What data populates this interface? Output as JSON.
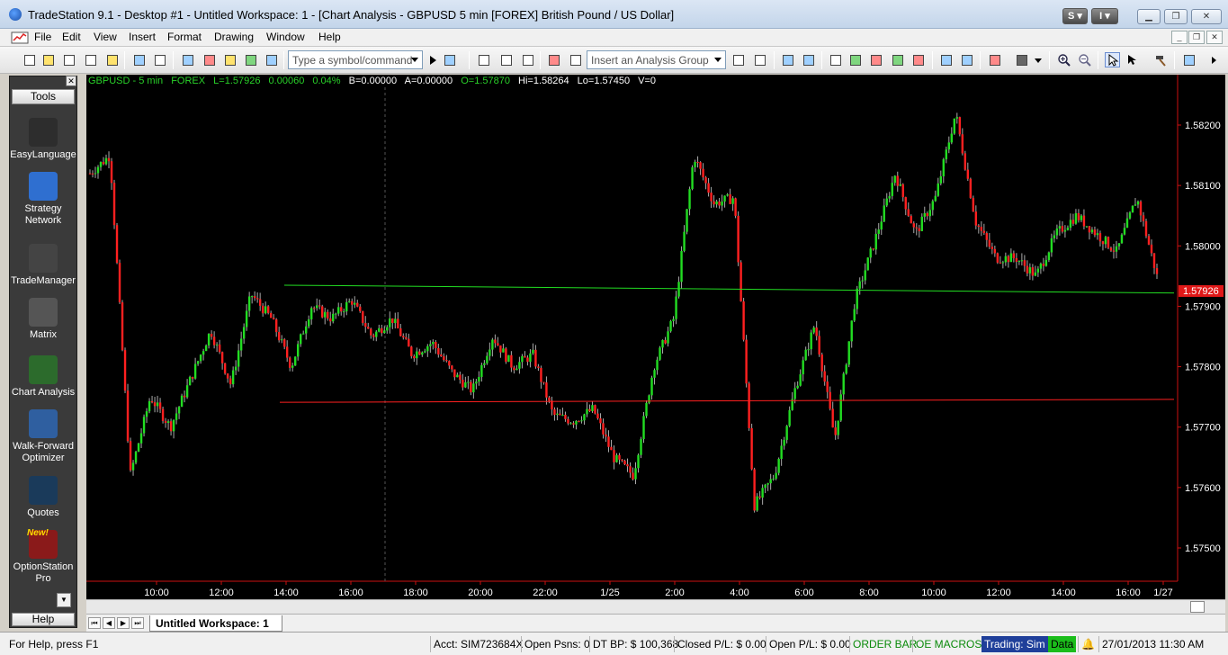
{
  "window": {
    "title": "TradeStation 9.1 - Desktop #1 - Untitled Workspace:  1 - [Chart Analysis - GBPUSD 5 min [FOREX] British Pound / US Dollar]",
    "s_button": "S",
    "i_button": "I"
  },
  "menu": {
    "items": [
      "File",
      "Edit",
      "View",
      "Insert",
      "Format",
      "Drawing",
      "Window",
      "Help"
    ]
  },
  "toolbar": {
    "symbol_placeholder": "Type a symbol/command",
    "analysis_group_placeholder": "Insert an Analysis Group"
  },
  "tools": {
    "header": "Tools",
    "footer": "Help",
    "items": [
      {
        "line1": "EasyLanguage",
        "line2": "",
        "icon": "easylanguage-icon",
        "color": "#2d2d2d"
      },
      {
        "line1": "Strategy",
        "line2": "Network",
        "icon": "strategy-network-icon",
        "color": "#2f6fd0"
      },
      {
        "line1": "TradeManager",
        "line2": "",
        "icon": "trademanager-icon",
        "color": "#444444"
      },
      {
        "line1": "Matrix",
        "line2": "",
        "icon": "matrix-icon",
        "color": "#555555"
      },
      {
        "line1": "Chart Analysis",
        "line2": "",
        "icon": "chart-analysis-icon",
        "color": "#2c6b2c"
      },
      {
        "line1": "Walk-Forward",
        "line2": "Optimizer",
        "icon": "walk-forward-optimizer-icon",
        "color": "#2f5fa0"
      },
      {
        "line1": "Quotes",
        "line2": "",
        "icon": "quotes-icon",
        "color": "#1a3a5a"
      },
      {
        "line1": "OptionStation",
        "line2": "Pro",
        "icon": "optionstation-pro-icon",
        "color": "#8a1a1a",
        "badge": "New!"
      }
    ]
  },
  "chart_header": {
    "symbol": "GBPUSD - 5 min",
    "exchange": "FOREX",
    "last": "L=1.57926",
    "change": "0.00060",
    "change_pct": "0.04%",
    "bid": "B=0.00000",
    "ask": "A=0.00000",
    "open": "O=1.57870",
    "high": "Hi=1.58264",
    "low": "Lo=1.57450",
    "volume": "V=0",
    "colors": {
      "green": "#29d129",
      "white": "#ffffff"
    }
  },
  "chart_data": {
    "type": "candlestick",
    "y_ticks": [
      "1.58200",
      "1.58100",
      "1.58000",
      "1.57900",
      "1.57800",
      "1.57700",
      "1.57600",
      "1.57500"
    ],
    "x_ticks": [
      "10:00",
      "12:00",
      "14:00",
      "16:00",
      "18:00",
      "20:00",
      "22:00",
      "1/25",
      "2:00",
      "4:00",
      "6:00",
      "8:00",
      "10:00",
      "12:00",
      "14:00",
      "16:00",
      "1/27"
    ],
    "last_price_label": "1.57926",
    "ylim": [
      1.5743,
      1.5831
    ],
    "up_color": "#22dd22",
    "down_color": "#ff2020",
    "trendlines": [
      {
        "color": "#22dd22",
        "from": {
          "time": "13:55",
          "price": 1.57926
        },
        "to": {
          "time": "1/27 17:00",
          "price": 1.57922
        }
      },
      {
        "color": "#ff2020",
        "from": {
          "time": "13:50",
          "price": 1.57741
        },
        "to": {
          "time": "1/27 17:00",
          "price": 1.57746
        }
      }
    ],
    "closes_path": [
      1.5812,
      1.5815,
      1.5762,
      1.5775,
      1.577,
      1.5778,
      1.5786,
      1.5777,
      1.5792,
      1.5788,
      1.578,
      1.579,
      1.5788,
      1.5791,
      1.5785,
      1.5788,
      1.5782,
      1.5784,
      1.5779,
      1.5776,
      1.5785,
      1.578,
      1.5782,
      1.5772,
      1.5771,
      1.5773,
      1.5765,
      1.5762,
      1.578,
      1.5788,
      1.5815,
      1.5807,
      1.5808,
      1.5757,
      1.5762,
      1.5776,
      1.5787,
      1.5768,
      1.5791,
      1.5801,
      1.5812,
      1.5802,
      1.5808,
      1.5822,
      1.5804,
      1.5798,
      1.5798,
      1.5795,
      1.5802,
      1.5805,
      1.5802,
      1.5799,
      1.5808,
      1.5795
    ]
  },
  "workspace": {
    "tab": "Untitled Workspace:  1"
  },
  "status": {
    "help": "For Help, press F1",
    "account": "Acct: SIM723684X",
    "open_positions": "Open Psns: 0",
    "dt_bp": "DT BP: $ 100,368",
    "closed_pl": "Closed P/L: $ 0.00",
    "open_pl": "Open P/L: $ 0.00",
    "order_bar": "ORDER BAR",
    "oe_macros": "OE MACROS",
    "trading": "Trading: Sim",
    "data": "Data",
    "datetime": "27/01/2013 11:30 AM"
  }
}
